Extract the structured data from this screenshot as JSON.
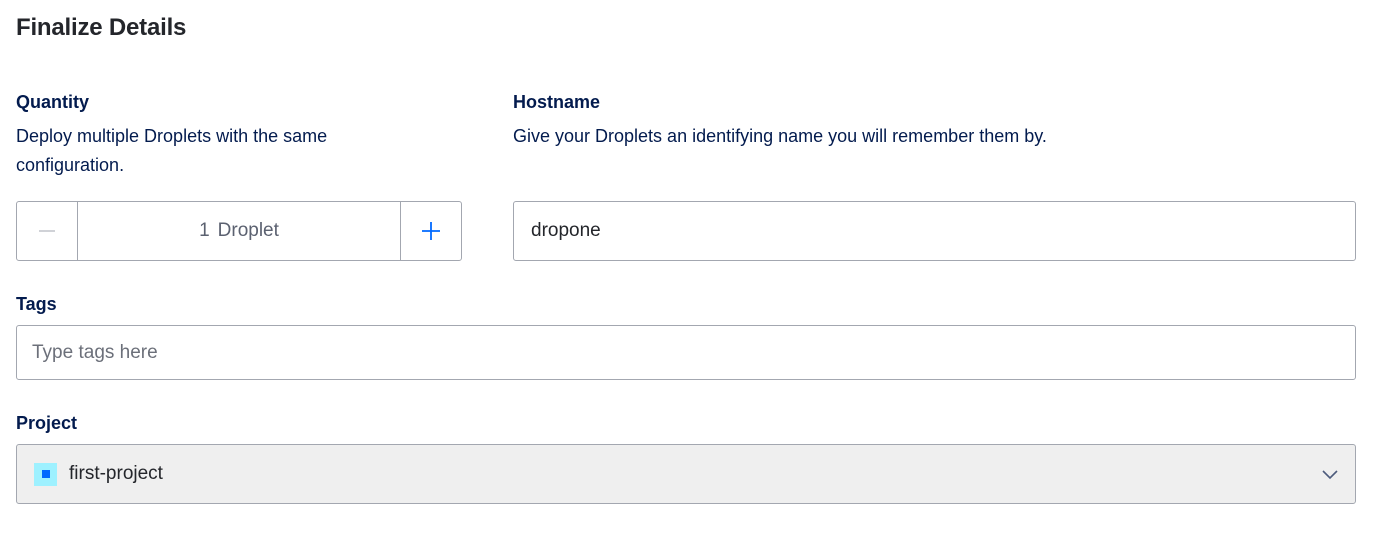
{
  "title": "Finalize Details",
  "quantity": {
    "label": "Quantity",
    "description_line1": "Deploy multiple Droplets with the same",
    "description_line2": "configuration.",
    "count": "1",
    "unit": "Droplet",
    "minus_icon": "minus-icon",
    "plus_icon": "plus-icon"
  },
  "hostname": {
    "label": "Hostname",
    "description": "Give your Droplets an identifying name you will remember them by.",
    "value": "dropone"
  },
  "tags": {
    "label": "Tags",
    "placeholder": "Type tags here"
  },
  "project": {
    "label": "Project",
    "selected": "first-project",
    "icon": "project-square-icon",
    "dropdown_icon": "chevron-down-icon"
  },
  "colors": {
    "accent": "#0069ff",
    "text_primary": "#031b4e",
    "border": "#a3a7b0",
    "project_icon_bg": "#9ef1ff"
  }
}
